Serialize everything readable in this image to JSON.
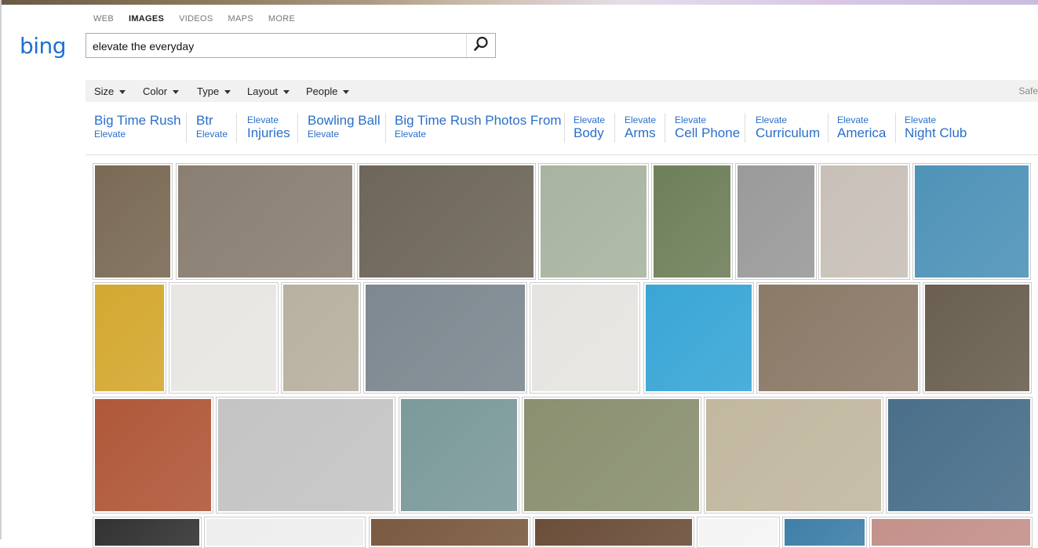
{
  "nav": {
    "items": [
      {
        "label": "WEB",
        "active": false
      },
      {
        "label": "IMAGES",
        "active": true
      },
      {
        "label": "VIDEOS",
        "active": false
      },
      {
        "label": "MAPS",
        "active": false
      },
      {
        "label": "MORE",
        "active": false
      }
    ]
  },
  "logo": "bing",
  "search": {
    "value": "elevate the everyday",
    "button_icon": "search-icon"
  },
  "filters": [
    "Size",
    "Color",
    "Type",
    "Layout",
    "People"
  ],
  "safe_search_label": "Safe",
  "related": [
    {
      "big": "Big Time Rush",
      "small": "Elevate",
      "order": "big-first"
    },
    {
      "big": "Btr",
      "small": "Elevate",
      "order": "big-first"
    },
    {
      "big": "Injuries",
      "small": "Elevate",
      "order": "small-first"
    },
    {
      "big": "Bowling Ball",
      "small": "Elevate",
      "order": "big-first"
    },
    {
      "big": "Big Time Rush Photos From",
      "small": "Elevate",
      "order": "big-first"
    },
    {
      "big": "Body",
      "small": "Elevate",
      "order": "small-first"
    },
    {
      "big": "Arms",
      "small": "Elevate",
      "order": "small-first"
    },
    {
      "big": "Cell Phone",
      "small": "Elevate",
      "order": "small-first"
    },
    {
      "big": "Curriculum",
      "small": "Elevate",
      "order": "small-first"
    },
    {
      "big": "America",
      "small": "Elevate",
      "order": "small-first"
    },
    {
      "big": "Night Club",
      "small": "Elevate",
      "order": "small-first"
    }
  ],
  "results": [
    {
      "name": "book-cover-on-brick",
      "color": "#7a6a55"
    },
    {
      "name": "open-book-details",
      "color": "#8a7f72"
    },
    {
      "name": "open-book-pages",
      "color": "#6e665a"
    },
    {
      "name": "woman-with-camera-book",
      "color": "#a8b4a0"
    },
    {
      "name": "caladium-leaves",
      "color": "#6f7f5a"
    },
    {
      "name": "woman-camera-bw",
      "color": "#9a9a9a"
    },
    {
      "name": "book-cover-white",
      "color": "#c8c0b8"
    },
    {
      "name": "elevate-the-everyday-cover",
      "color": "#4f93b8"
    },
    {
      "name": "sunflower",
      "color": "#d4a830"
    },
    {
      "name": "spice-jar",
      "color": "#e8e6e2"
    },
    {
      "name": "bbq-funnel",
      "color": "#b8b0a0"
    },
    {
      "name": "computer-keyboard-work",
      "color": "#7d8890"
    },
    {
      "name": "journal-notebook",
      "color": "#e6e4e0"
    },
    {
      "name": "august-elevate-list",
      "color": "#3aa6d6"
    },
    {
      "name": "kitchen-stove",
      "color": "#8c7a68"
    },
    {
      "name": "hand-feeding-chicken",
      "color": "#6a5f50"
    },
    {
      "name": "sun-rays-drink",
      "color": "#b0583a"
    },
    {
      "name": "book-heart-pages",
      "color": "#c4c4c4"
    },
    {
      "name": "pink-stool",
      "color": "#7c9a9a"
    },
    {
      "name": "feet-on-porch",
      "color": "#8a9070"
    },
    {
      "name": "bed-sheets",
      "color": "#c2b8a0"
    },
    {
      "name": "book-cover-on-table",
      "color": "#4a6f8a"
    },
    {
      "name": "round-logo",
      "color": "#333333"
    },
    {
      "name": "blank-light",
      "color": "#eeeeee"
    },
    {
      "name": "dark-photo-1",
      "color": "#7a5a40"
    },
    {
      "name": "dark-photo-2",
      "color": "#6b4e3a"
    },
    {
      "name": "white-photo",
      "color": "#f4f4f4"
    },
    {
      "name": "blue-photo",
      "color": "#3f7fa8"
    },
    {
      "name": "pink-photo",
      "color": "#c4908a"
    }
  ]
}
